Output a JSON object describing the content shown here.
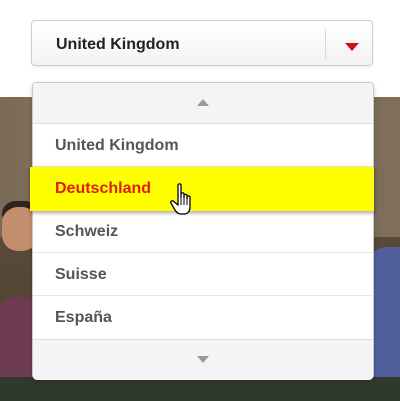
{
  "select": {
    "value": "United Kingdom",
    "caret_color": "#cc1111"
  },
  "dropdown": {
    "options": [
      {
        "label": "United Kingdom",
        "highlighted": false
      },
      {
        "label": "Deutschland",
        "highlighted": true
      },
      {
        "label": "Schweiz",
        "highlighted": false
      },
      {
        "label": "Suisse",
        "highlighted": false
      },
      {
        "label": "España",
        "highlighted": false
      }
    ],
    "highlight_color": "#ffff00",
    "highlight_text_color": "#e01b1b"
  },
  "icons": {
    "scroll_up": "chevron-up-icon",
    "scroll_down": "chevron-down-icon",
    "caret": "caret-down-icon",
    "cursor": "hand-pointer-icon"
  }
}
